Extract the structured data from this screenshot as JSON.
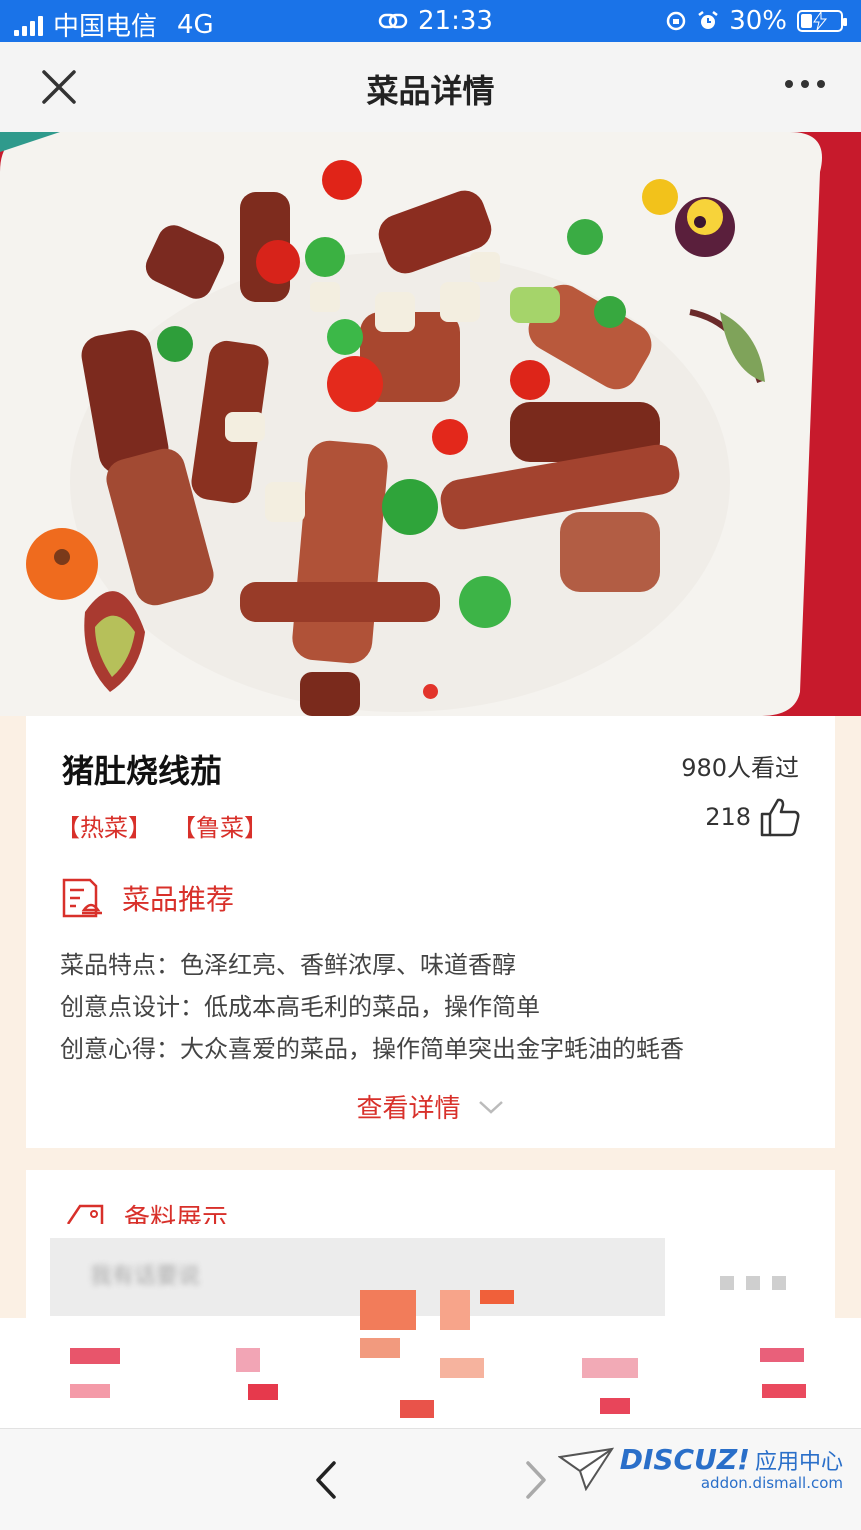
{
  "status_bar": {
    "carrier": "中国电信",
    "network": "4G",
    "time": "21:33",
    "battery_percent_label": "30%",
    "battery_level": 0.3
  },
  "nav": {
    "title": "菜品详情",
    "close_icon": "close-icon",
    "more_icon": "more-icon"
  },
  "hero": {
    "carousel_index": 1,
    "carousel_count": 1
  },
  "dish": {
    "name": "猪肚烧线茄",
    "views": "980人看过",
    "tags": [
      "【热菜】",
      "【鲁菜】"
    ],
    "likes": "218",
    "section_title": "菜品推荐",
    "description": [
      "菜品特点：色泽红亮、香鲜浓厚、味道香醇",
      "创意点设计：低成本高毛利的菜品，操作简单",
      "创意心得：大众喜爱的菜品，操作简单突出金字蚝油的蚝香"
    ],
    "more_link": "查看详情"
  },
  "ingredients": {
    "title": "备料展示",
    "search_placeholder": "我有话要说"
  },
  "watermark": {
    "brand": "DISCUZ!",
    "brand_suffix": "应用中心",
    "domain": "addon.dismall.com"
  },
  "colors": {
    "accent": "#d8302a",
    "status_bar": "#1a73e8",
    "background": "#fbf0e4"
  }
}
